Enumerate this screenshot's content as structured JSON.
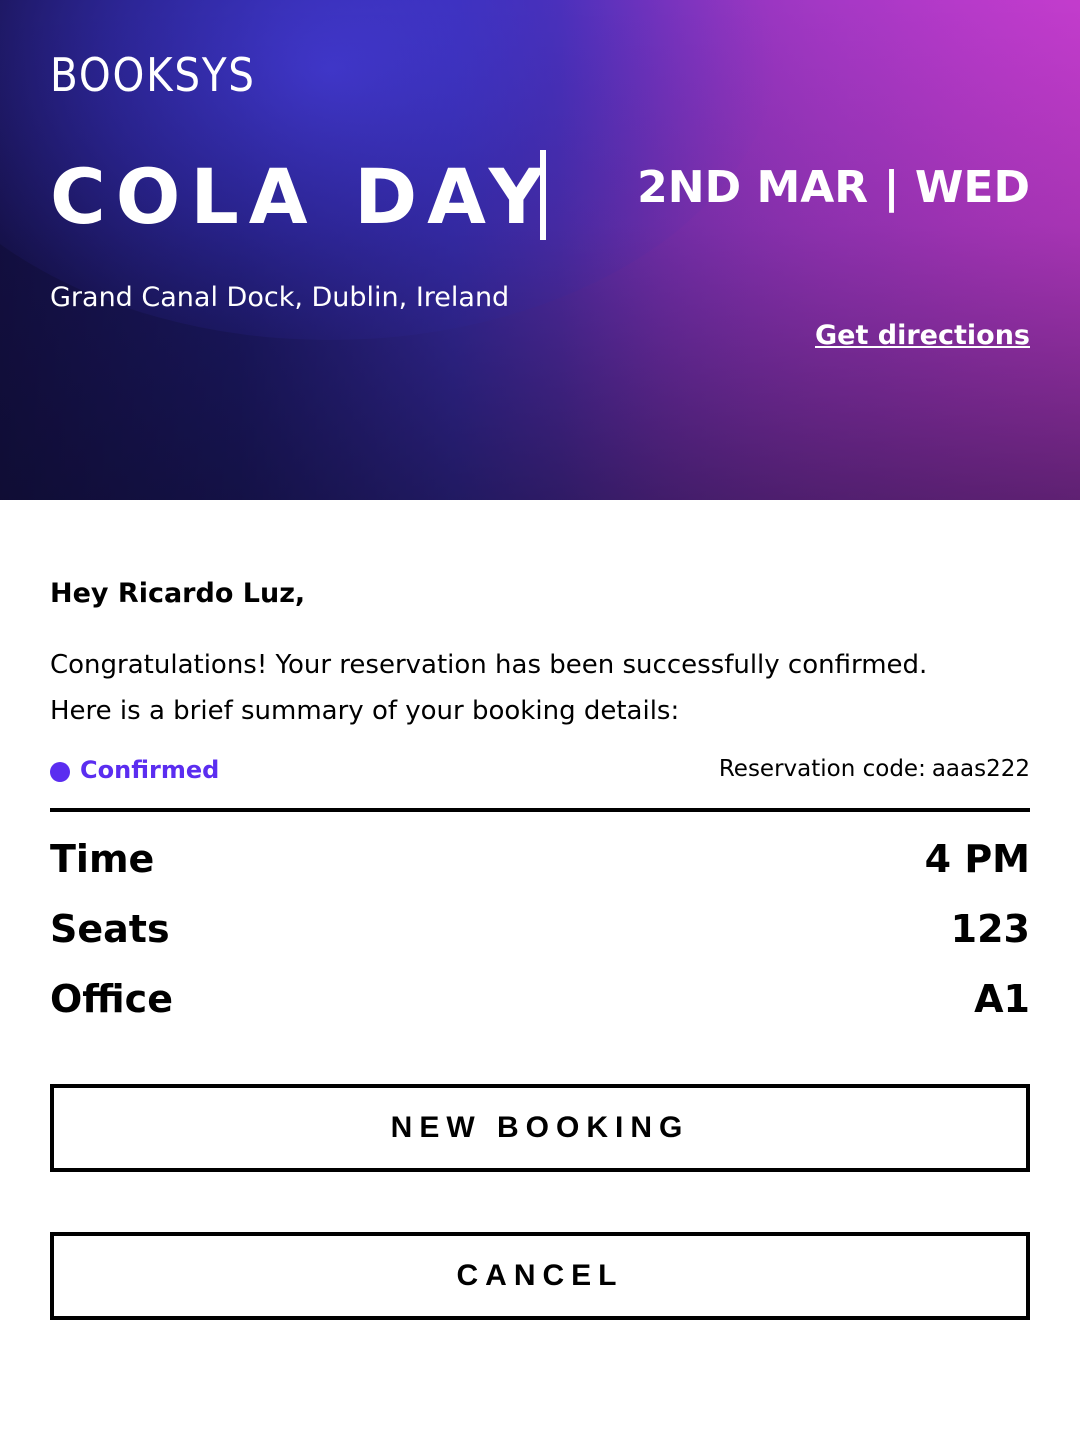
{
  "brand": {
    "logo_text": "BOOKSYS"
  },
  "event": {
    "title": "COLA DAY",
    "date": "2ND MAR | WED",
    "location": "Grand Canal Dock, Dublin, Ireland",
    "directions_label": "Get directions"
  },
  "message": {
    "greeting": "Hey Ricardo Luz,",
    "line1": "Congratulations! Your reservation has been successfully confirmed.",
    "line2": "Here is a brief summary of your booking details:"
  },
  "status": {
    "label": "Confirmed",
    "color": "#5b2df0"
  },
  "reservation": {
    "code_label": "Reservation code:",
    "code": "aaas222"
  },
  "details": [
    {
      "label": "Time",
      "value": "4 PM"
    },
    {
      "label": "Seats",
      "value": "123"
    },
    {
      "label": "Office",
      "value": "A1"
    }
  ],
  "actions": {
    "new_booking_label": "NEW BOOKING",
    "cancel_label": "CANCEL"
  }
}
